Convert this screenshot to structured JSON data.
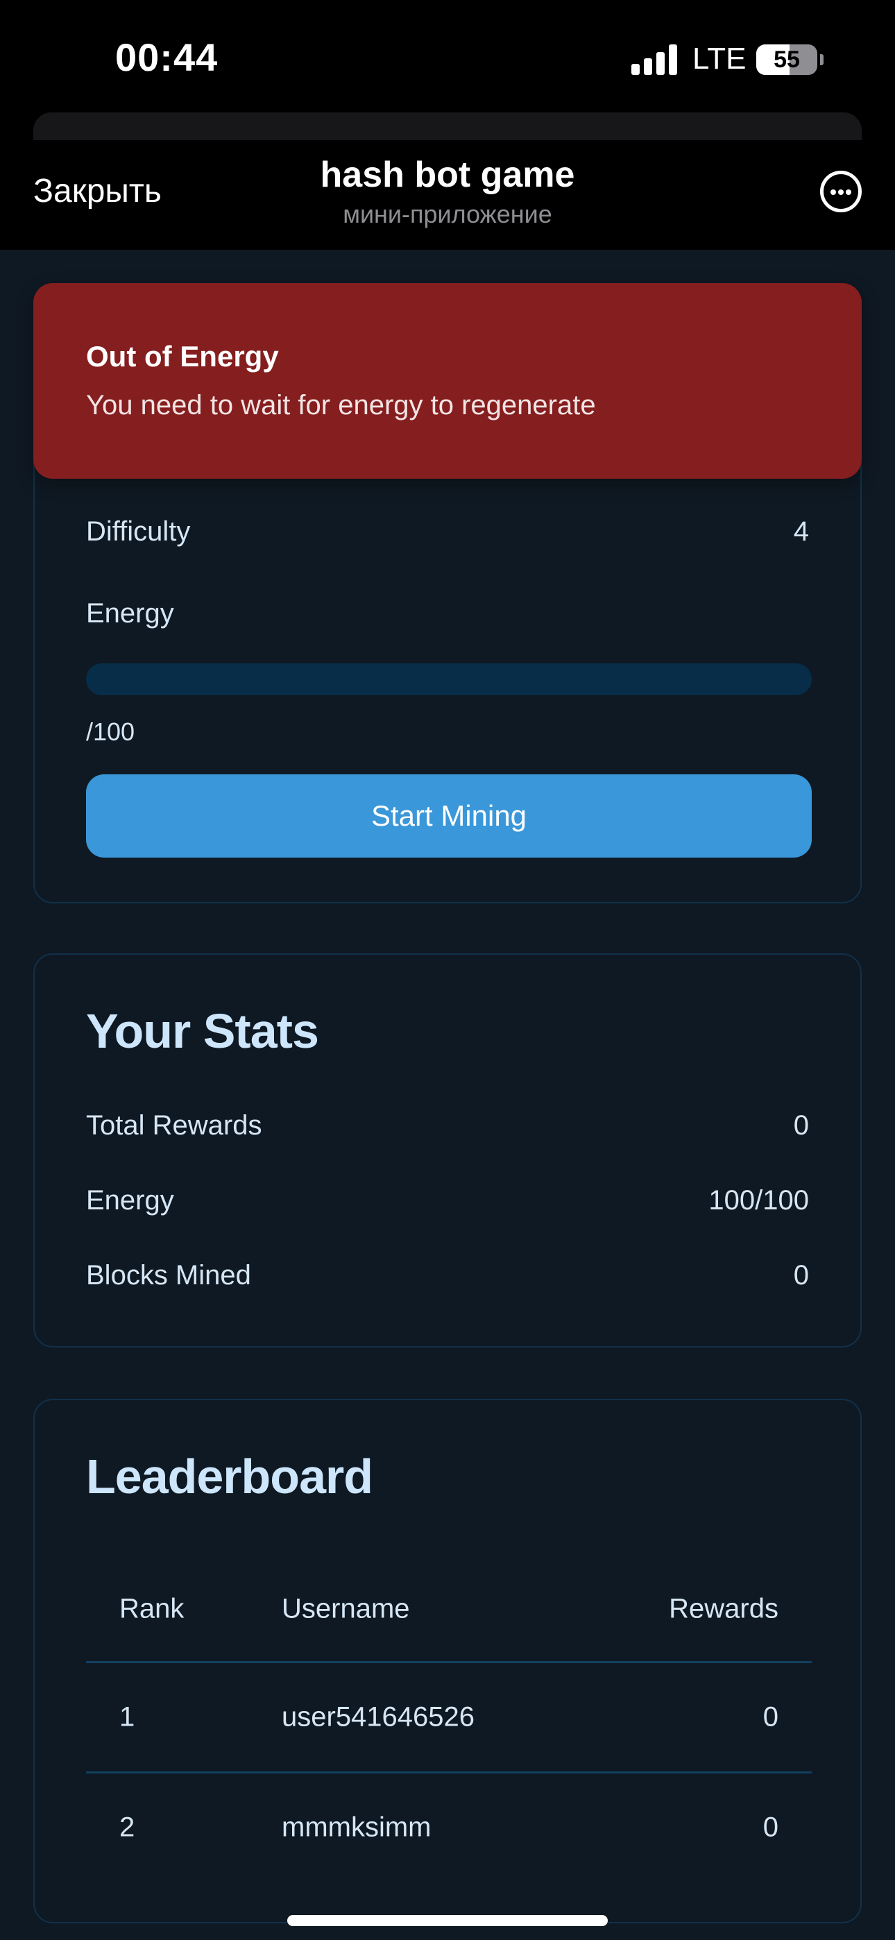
{
  "status_bar": {
    "time": "00:44",
    "network": "LTE",
    "battery_percent": "55",
    "battery_level": 0.55
  },
  "header": {
    "close_label": "Закрыть",
    "title": "hash bot game",
    "subtitle": "мини-приложение",
    "more_icon": "more-horizontal-icon"
  },
  "alert": {
    "title": "Out of Energy",
    "message": "You need to wait for energy to regenerate",
    "color": "#851e1f"
  },
  "mining": {
    "difficulty_label": "Difficulty",
    "difficulty_value": "4",
    "energy_label": "Energy",
    "energy_count": "/100",
    "energy_fill_fraction": 0,
    "start_button_label": "Start Mining",
    "accent_color": "#3a97d9"
  },
  "stats": {
    "title": "Your Stats",
    "rows": [
      {
        "label": "Total Rewards",
        "value": "0"
      },
      {
        "label": "Energy",
        "value": "100/100"
      },
      {
        "label": "Blocks Mined",
        "value": "0"
      }
    ]
  },
  "leaderboard": {
    "title": "Leaderboard",
    "columns": [
      "Rank",
      "Username",
      "Rewards"
    ],
    "rows": [
      {
        "rank": "1",
        "username": "user541646526",
        "rewards": "0"
      },
      {
        "rank": "2",
        "username": "mmmksimm",
        "rewards": "0"
      }
    ]
  }
}
